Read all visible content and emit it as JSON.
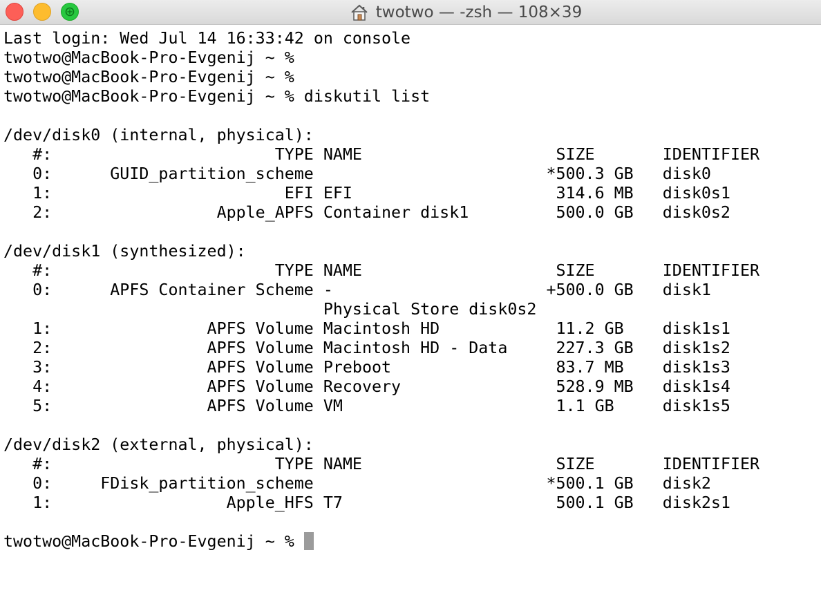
{
  "window": {
    "title": "twotwo — -zsh — 108×39",
    "title_icon": "home-icon",
    "accent": {
      "close": "#fd5f57",
      "minimize": "#fdbc2e",
      "zoom": "#28c840"
    }
  },
  "terminal": {
    "lines": [
      "Last login: Wed Jul 14 16:33:42 on console",
      "twotwo@MacBook-Pro-Evgenij ~ %",
      "twotwo@MacBook-Pro-Evgenij ~ %",
      "twotwo@MacBook-Pro-Evgenij ~ % diskutil list",
      "",
      "/dev/disk0 (internal, physical):",
      "   #:                       TYPE NAME                    SIZE       IDENTIFIER",
      "   0:      GUID_partition_scheme                        *500.3 GB   disk0",
      "   1:                        EFI EFI                     314.6 MB   disk0s1",
      "   2:                 Apple_APFS Container disk1         500.0 GB   disk0s2",
      "",
      "/dev/disk1 (synthesized):",
      "   #:                       TYPE NAME                    SIZE       IDENTIFIER",
      "   0:      APFS Container Scheme -                      +500.0 GB   disk1",
      "                                 Physical Store disk0s2",
      "   1:                APFS Volume Macintosh HD            11.2 GB    disk1s1",
      "   2:                APFS Volume Macintosh HD - Data     227.3 GB   disk1s2",
      "   3:                APFS Volume Preboot                 83.7 MB    disk1s3",
      "   4:                APFS Volume Recovery                528.9 MB   disk1s4",
      "   5:                APFS Volume VM                      1.1 GB     disk1s5",
      "",
      "/dev/disk2 (external, physical):",
      "   #:                       TYPE NAME                    SIZE       IDENTIFIER",
      "   0:     FDisk_partition_scheme                        *500.1 GB   disk2",
      "   1:                  Apple_HFS T7                      500.1 GB   disk2s1",
      ""
    ],
    "prompt": "twotwo@MacBook-Pro-Evgenij ~ % "
  }
}
